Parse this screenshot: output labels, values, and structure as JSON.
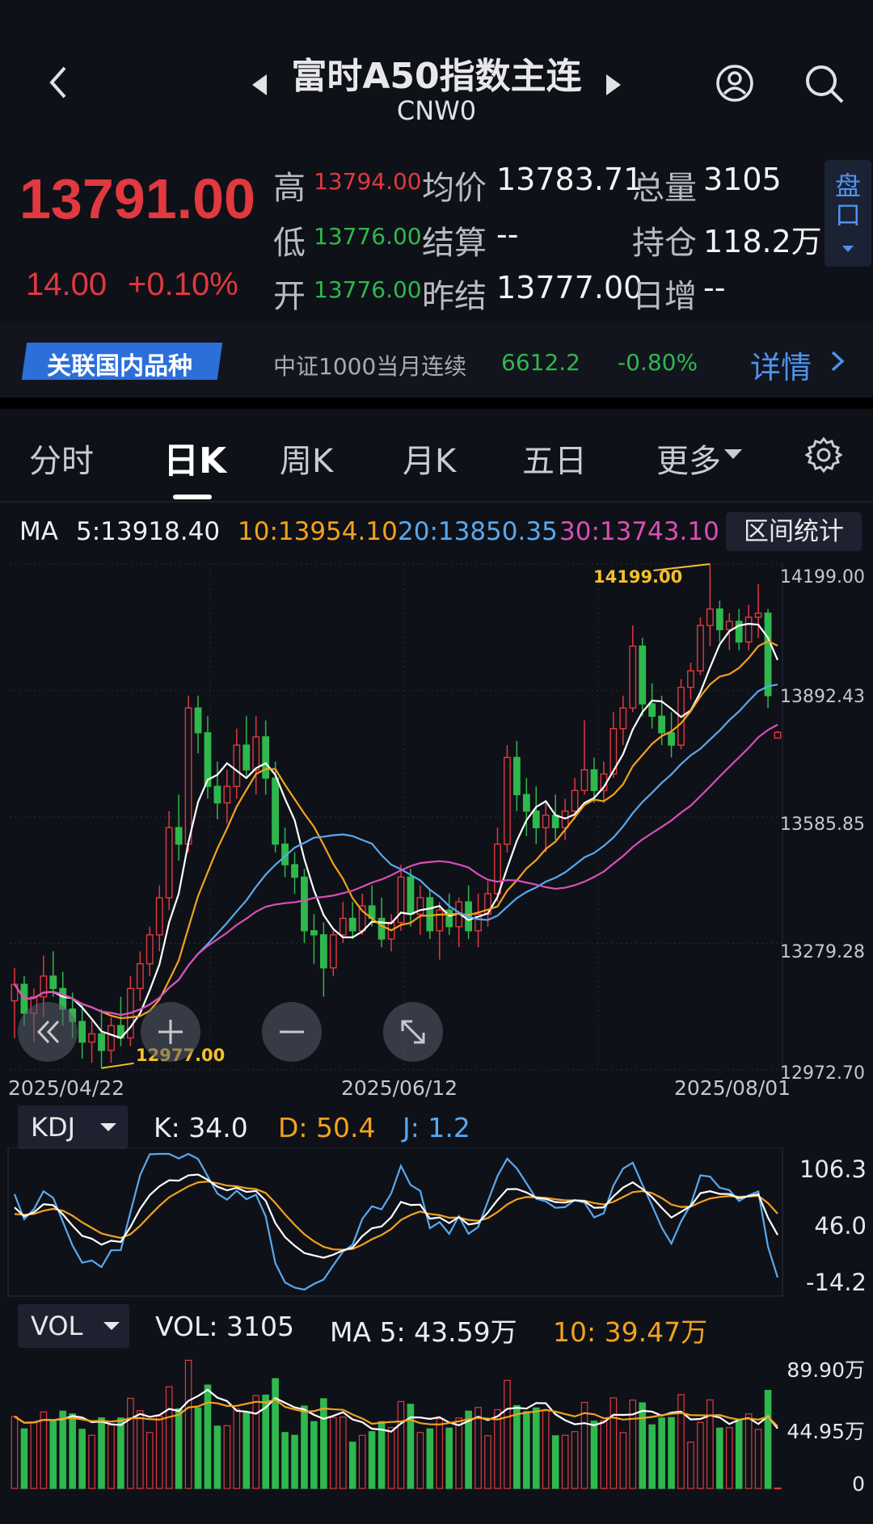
{
  "header": {
    "title": "富时A50指数主连",
    "code": "CNW0"
  },
  "quote": {
    "price": "13791.00",
    "change": "14.00",
    "change_pct": "+0.10%",
    "high_label": "高",
    "high": "13794.00",
    "low_label": "低",
    "low": "13776.00",
    "open_label": "开",
    "open": "13776.00",
    "avg_label": "均价",
    "avg": "13783.71",
    "settle_label": "结算",
    "settle": "--",
    "prev_settle_label": "昨结",
    "prev_settle": "13777.00",
    "vol_label": "总量",
    "vol": "3105",
    "oi_label": "持仓",
    "oi": "118.2万",
    "day_inc_label": "日增",
    "day_inc": "--",
    "panel_button": "盘口"
  },
  "related": {
    "badge": "关联国内品种",
    "name": "中证1000当月连续",
    "price": "6612.2",
    "pct": "-0.80%",
    "detail": "详情"
  },
  "tabs": [
    "分时",
    "日K",
    "周K",
    "月K",
    "五日",
    "更多"
  ],
  "ma_legend": {
    "label": "MA",
    "ma5": "5:13918.40",
    "ma10": "10:13954.10",
    "ma20": "20:13850.35",
    "ma30": "30:13743.10",
    "range_button": "区间统计"
  },
  "colors": {
    "up": "#e2383f",
    "down": "#2fb84d",
    "ma5": "#ffffff",
    "ma10": "#f3a21e",
    "ma20": "#58a9f0",
    "ma30": "#d94fb6"
  },
  "kdj": {
    "label": "KDJ",
    "k": "K: 34.0",
    "d": "D: 50.4",
    "j": "J: 1.2"
  },
  "vol": {
    "label": "VOL",
    "vol": "VOL: 3105",
    "ma5": "MA 5: 43.59万",
    "ma10": "10: 39.47万"
  },
  "chart_data": [
    {
      "type": "candlestick",
      "x_labels": [
        "2025/04/22",
        "2025/06/12",
        "2025/08/01"
      ],
      "y_ticks": [
        "14199.00",
        "13892.43",
        "13585.85",
        "13279.28",
        "12972.70"
      ],
      "ylim": [
        12972.7,
        14199.0
      ],
      "annotations": {
        "max": "14199.00",
        "min": "12977.00"
      },
      "candles": [
        {
          "o": 13140,
          "h": 13220,
          "l": 13050,
          "c": 13180
        },
        {
          "o": 13180,
          "h": 13200,
          "l": 13080,
          "c": 13110
        },
        {
          "o": 13110,
          "h": 13170,
          "l": 13040,
          "c": 13150
        },
        {
          "o": 13150,
          "h": 13250,
          "l": 13100,
          "c": 13200
        },
        {
          "o": 13200,
          "h": 13260,
          "l": 13150,
          "c": 13170
        },
        {
          "o": 13170,
          "h": 13210,
          "l": 13080,
          "c": 13120
        },
        {
          "o": 13120,
          "h": 13160,
          "l": 13050,
          "c": 13090
        },
        {
          "o": 13090,
          "h": 13130,
          "l": 13000,
          "c": 13040
        },
        {
          "o": 13040,
          "h": 13090,
          "l": 12990,
          "c": 13060
        },
        {
          "o": 13060,
          "h": 13120,
          "l": 12977,
          "c": 13020
        },
        {
          "o": 13020,
          "h": 13100,
          "l": 12990,
          "c": 13080
        },
        {
          "o": 13080,
          "h": 13150,
          "l": 13030,
          "c": 13050
        },
        {
          "o": 13050,
          "h": 13200,
          "l": 13030,
          "c": 13170
        },
        {
          "o": 13170,
          "h": 13260,
          "l": 13140,
          "c": 13230
        },
        {
          "o": 13230,
          "h": 13320,
          "l": 13200,
          "c": 13300
        },
        {
          "o": 13300,
          "h": 13420,
          "l": 13260,
          "c": 13390
        },
        {
          "o": 13390,
          "h": 13600,
          "l": 13360,
          "c": 13560
        },
        {
          "o": 13560,
          "h": 13640,
          "l": 13480,
          "c": 13520
        },
        {
          "o": 13520,
          "h": 13880,
          "l": 13500,
          "c": 13850
        },
        {
          "o": 13850,
          "h": 13880,
          "l": 13740,
          "c": 13790
        },
        {
          "o": 13790,
          "h": 13830,
          "l": 13630,
          "c": 13660
        },
        {
          "o": 13660,
          "h": 13720,
          "l": 13580,
          "c": 13620
        },
        {
          "o": 13620,
          "h": 13700,
          "l": 13570,
          "c": 13660
        },
        {
          "o": 13660,
          "h": 13800,
          "l": 13630,
          "c": 13760
        },
        {
          "o": 13760,
          "h": 13830,
          "l": 13680,
          "c": 13700
        },
        {
          "o": 13700,
          "h": 13830,
          "l": 13640,
          "c": 13780
        },
        {
          "o": 13780,
          "h": 13820,
          "l": 13640,
          "c": 13680
        },
        {
          "o": 13680,
          "h": 13720,
          "l": 13500,
          "c": 13520
        },
        {
          "o": 13520,
          "h": 13560,
          "l": 13440,
          "c": 13470
        },
        {
          "o": 13470,
          "h": 13500,
          "l": 13400,
          "c": 13440
        },
        {
          "o": 13440,
          "h": 13460,
          "l": 13280,
          "c": 13310
        },
        {
          "o": 13310,
          "h": 13350,
          "l": 13230,
          "c": 13300
        },
        {
          "o": 13300,
          "h": 13330,
          "l": 13150,
          "c": 13220
        },
        {
          "o": 13220,
          "h": 13310,
          "l": 13200,
          "c": 13300
        },
        {
          "o": 13300,
          "h": 13380,
          "l": 13280,
          "c": 13340
        },
        {
          "o": 13340,
          "h": 13380,
          "l": 13290,
          "c": 13310
        },
        {
          "o": 13310,
          "h": 13400,
          "l": 13300,
          "c": 13370
        },
        {
          "o": 13370,
          "h": 13420,
          "l": 13320,
          "c": 13340
        },
        {
          "o": 13340,
          "h": 13390,
          "l": 13270,
          "c": 13290
        },
        {
          "o": 13290,
          "h": 13350,
          "l": 13260,
          "c": 13330
        },
        {
          "o": 13330,
          "h": 13470,
          "l": 13310,
          "c": 13440
        },
        {
          "o": 13440,
          "h": 13460,
          "l": 13320,
          "c": 13350
        },
        {
          "o": 13350,
          "h": 13420,
          "l": 13300,
          "c": 13390
        },
        {
          "o": 13390,
          "h": 13410,
          "l": 13290,
          "c": 13310
        },
        {
          "o": 13310,
          "h": 13380,
          "l": 13240,
          "c": 13360
        },
        {
          "o": 13360,
          "h": 13400,
          "l": 13300,
          "c": 13320
        },
        {
          "o": 13320,
          "h": 13390,
          "l": 13270,
          "c": 13380
        },
        {
          "o": 13380,
          "h": 13420,
          "l": 13290,
          "c": 13310
        },
        {
          "o": 13310,
          "h": 13400,
          "l": 13270,
          "c": 13350
        },
        {
          "o": 13350,
          "h": 13430,
          "l": 13320,
          "c": 13400
        },
        {
          "o": 13400,
          "h": 13560,
          "l": 13380,
          "c": 13520
        },
        {
          "o": 13520,
          "h": 13760,
          "l": 13500,
          "c": 13730
        },
        {
          "o": 13730,
          "h": 13770,
          "l": 13600,
          "c": 13640
        },
        {
          "o": 13640,
          "h": 13680,
          "l": 13540,
          "c": 13600
        },
        {
          "o": 13600,
          "h": 13660,
          "l": 13520,
          "c": 13560
        },
        {
          "o": 13560,
          "h": 13620,
          "l": 13500,
          "c": 13590
        },
        {
          "o": 13590,
          "h": 13640,
          "l": 13530,
          "c": 13560
        },
        {
          "o": 13560,
          "h": 13630,
          "l": 13530,
          "c": 13600
        },
        {
          "o": 13600,
          "h": 13680,
          "l": 13580,
          "c": 13650
        },
        {
          "o": 13650,
          "h": 13820,
          "l": 13640,
          "c": 13700
        },
        {
          "o": 13700,
          "h": 13730,
          "l": 13620,
          "c": 13650
        },
        {
          "o": 13650,
          "h": 13720,
          "l": 13620,
          "c": 13690
        },
        {
          "o": 13690,
          "h": 13840,
          "l": 13680,
          "c": 13800
        },
        {
          "o": 13800,
          "h": 13880,
          "l": 13760,
          "c": 13850
        },
        {
          "o": 13850,
          "h": 14050,
          "l": 13840,
          "c": 14000
        },
        {
          "o": 14000,
          "h": 14020,
          "l": 13830,
          "c": 13860
        },
        {
          "o": 13860,
          "h": 13910,
          "l": 13800,
          "c": 13830
        },
        {
          "o": 13830,
          "h": 13880,
          "l": 13760,
          "c": 13790
        },
        {
          "o": 13790,
          "h": 13840,
          "l": 13730,
          "c": 13760
        },
        {
          "o": 13760,
          "h": 13920,
          "l": 13750,
          "c": 13900
        },
        {
          "o": 13900,
          "h": 13960,
          "l": 13870,
          "c": 13940
        },
        {
          "o": 13940,
          "h": 14070,
          "l": 13930,
          "c": 14050
        },
        {
          "o": 14050,
          "h": 14199,
          "l": 14000,
          "c": 14090
        },
        {
          "o": 14090,
          "h": 14110,
          "l": 14010,
          "c": 14040
        },
        {
          "o": 14040,
          "h": 14080,
          "l": 13990,
          "c": 14060
        },
        {
          "o": 14060,
          "h": 14090,
          "l": 13990,
          "c": 14010
        },
        {
          "o": 14010,
          "h": 14100,
          "l": 13990,
          "c": 14070
        },
        {
          "o": 14070,
          "h": 14150,
          "l": 14020,
          "c": 14080
        },
        {
          "o": 14080,
          "h": 14090,
          "l": 13850,
          "c": 13880
        },
        {
          "o": 13777,
          "h": 13794,
          "l": 13776,
          "c": 13791
        }
      ]
    },
    {
      "type": "line",
      "name": "KDJ",
      "y_ticks": [
        "106.3",
        "46.0",
        "-14.2"
      ],
      "ylim": [
        -14.2,
        106.3
      ]
    },
    {
      "type": "bar",
      "name": "VOL",
      "y_ticks": [
        "89.90万",
        "44.95万",
        "0"
      ],
      "ylim": [
        0,
        89.9
      ]
    }
  ]
}
